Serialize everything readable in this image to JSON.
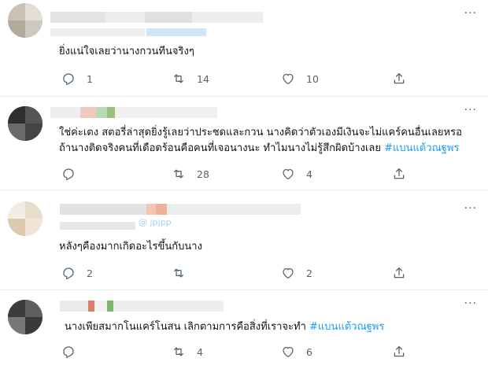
{
  "tweets": [
    {
      "text": "ยิ่งแน่ใจเลยว่านางกวนทีนจริงๆ",
      "stats": {
        "reply": "1",
        "retweet": "14",
        "like": "10"
      }
    },
    {
      "text_line1": "ใช่ค่ะเตง สตอรี่ล่าสุดยิ่งรู้เลยว่าประชดและกวน นางคิดว่าตัวเองมีเงินจะไม่แคร์คนอื่นเลยหรอ",
      "text_line2": "ถ้านางติดจริงคนที่เดือดร้อนคือคนที่เจอนางนะ ทำไมนางไม่รู้สึกผิดบ้างเลย ",
      "hashtag": "#แบนแต้วณฐพร",
      "stats": {
        "reply": "",
        "retweet": "28",
        "like": "4"
      }
    },
    {
      "handle_fragment": "@ jpjpp",
      "text": "หลังๆคืองมากเกิดอะไรขึ้นกับนาง",
      "stats": {
        "reply": "2",
        "retweet": "",
        "like": "2"
      }
    },
    {
      "text": "นางเพียสมากโนแคร์โนสน เลิกตามการคือสิ่งที่เราจะทำ ",
      "hashtag": "#แบนแต้วณฐพร",
      "stats": {
        "reply": "",
        "retweet": "4",
        "like": "6"
      }
    }
  ],
  "icons": [
    "reply-icon",
    "retweet-icon",
    "like-icon",
    "share-icon",
    "more-icon"
  ],
  "colors": {
    "text": "#0f1419",
    "muted": "#536471",
    "link": "#1d9bf0",
    "divider": "#e6ecf0"
  }
}
